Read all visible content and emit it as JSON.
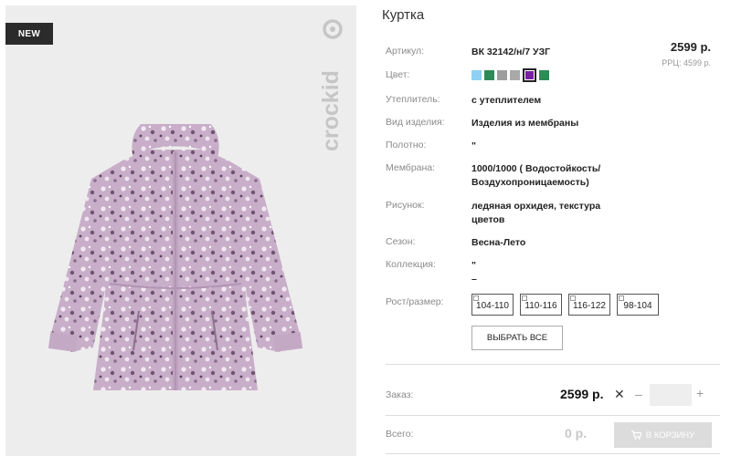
{
  "badge": "NEW",
  "brand": "crockid",
  "product": {
    "title": "Куртка",
    "price": "2599 р.",
    "rrc": "РРЦ: 4599 р."
  },
  "specs": {
    "article": {
      "label": "Артикул:",
      "value": "ВК 32142/н/7 УЗГ"
    },
    "color": {
      "label": "Цвет:"
    },
    "insulation": {
      "label": "Утеплитель:",
      "value": "с утеплителем"
    },
    "type": {
      "label": "Вид изделия:",
      "value": "Изделия из мембраны"
    },
    "fabric": {
      "label": "Полотно:",
      "value": "\""
    },
    "membrane": {
      "label": "Мембрана:",
      "value": "1000/1000 ( Водостойкость/ Воздухопроницаемость)"
    },
    "pattern": {
      "label": "Рисунок:",
      "value": "ледяная орхидея, текстура цветов"
    },
    "season": {
      "label": "Сезон:",
      "value": "Весна-Лето"
    },
    "collection": {
      "label": "Коллекция:",
      "value_line1": "\"",
      "value_line2": "–"
    }
  },
  "swatches": [
    {
      "color": "#8fd0f3",
      "selected": false
    },
    {
      "color": "#2e8b57",
      "selected": false
    },
    {
      "color": "#9e9e9e",
      "selected": false
    },
    {
      "color": "#a9a9a9",
      "selected": false
    },
    {
      "color": "#7b1fa2",
      "selected": true
    },
    {
      "color": "#2e8b57",
      "selected": false
    }
  ],
  "sizes": {
    "label": "Рост/размер:",
    "options": [
      "104-110",
      "110-116",
      "116-122",
      "98-104"
    ],
    "select_all": "ВЫБРАТЬ ВСЕ"
  },
  "order": {
    "label": "Заказ:",
    "price": "2599 р.",
    "times": "✕",
    "minus": "–",
    "plus": "+",
    "quantity": ""
  },
  "total": {
    "label": "Всего:",
    "price": "0 р.",
    "cart_button": "В КОРЗИНУ"
  },
  "colors": {
    "jacket_base": "#c8aec9",
    "flower_dark": "#6f5470",
    "flower_light": "#f2eaf3",
    "badge_bg": "#2b2b2b",
    "cart_button_bg": "#dcdcdc"
  }
}
